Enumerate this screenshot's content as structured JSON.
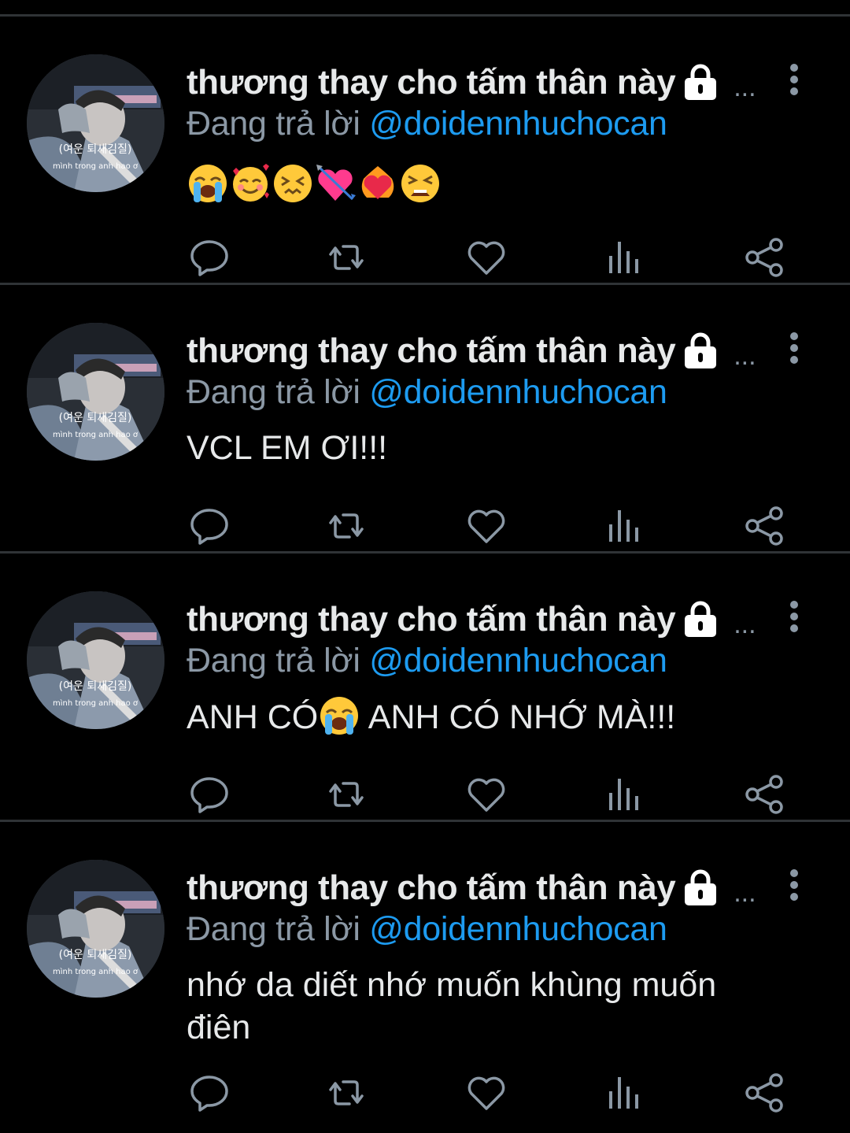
{
  "colors": {
    "background": "#000000",
    "divider": "#2f3336",
    "text": "#e7e9ea",
    "secondary": "#8b98a5",
    "link": "#1d9bf0"
  },
  "tweets": [
    {
      "display_name": "thương thay cho tấm thân này",
      "ellipsis": "...",
      "reply_prefix": "Đang trả lời",
      "reply_handle": "@doidennhuchocan",
      "text": "",
      "emojis": [
        "loudly-crying-face",
        "smiling-face-with-hearts",
        "confounded-face",
        "heart-with-arrow",
        "heart-on-fire",
        "tired-face"
      ]
    },
    {
      "display_name": "thương thay cho tấm thân này",
      "ellipsis": "...",
      "reply_prefix": "Đang trả lời",
      "reply_handle": "@doidennhuchocan",
      "text": "VCL EM ƠI!!!"
    },
    {
      "display_name": "thương thay cho tấm thân này",
      "ellipsis": "...",
      "reply_prefix": "Đang trả lời",
      "reply_handle": "@doidennhuchocan",
      "text_before": "ANH CÓ",
      "inline_emoji": "loudly-crying-face",
      "text_after": " ANH CÓ NHỚ MÀ!!!"
    },
    {
      "display_name": "thương thay cho tấm thân này",
      "ellipsis": "...",
      "reply_prefix": "Đang trả lời",
      "reply_handle": "@doidennhuchocan",
      "text": "nhớ da diết nhớ muốn khùng muốn điên"
    }
  ],
  "avatar_caption": {
    "line1": "(여운 퇴새김질)",
    "line2": "mình trong anh hao ơ"
  },
  "icons": {
    "lock": "lock-icon",
    "more": "more-vertical-icon",
    "reply": "reply-icon",
    "retweet": "retweet-icon",
    "like": "heart-icon",
    "analytics": "analytics-icon",
    "share": "share-icon"
  }
}
